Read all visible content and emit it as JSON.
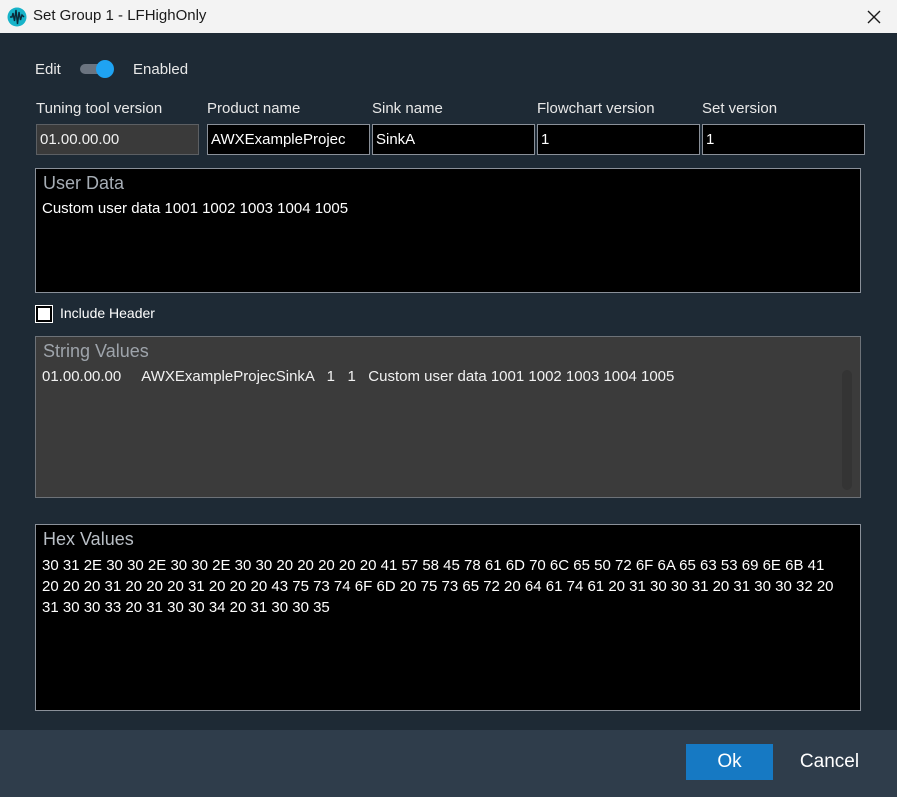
{
  "window": {
    "title": "Set Group 1 - LFHighOnly",
    "icon": "waveform-app-icon",
    "close_icon": "close-icon"
  },
  "edit": {
    "label": "Edit",
    "toggle_state": "on",
    "state_label": "Enabled",
    "accent_color": "#1fa3f2"
  },
  "fields": [
    {
      "label": "Tuning tool version",
      "value": "01.00.00.00",
      "readonly": true
    },
    {
      "label": "Product name",
      "value": "AWXExampleProjec"
    },
    {
      "label": "Sink name",
      "value": "SinkA"
    },
    {
      "label": "Flowchart version",
      "value": "1"
    },
    {
      "label": "Set version",
      "value": "1"
    }
  ],
  "user_data": {
    "title": "User Data",
    "text": "Custom user data 1001 1002 1003 1004 1005"
  },
  "include_header": {
    "label": "Include Header",
    "checked": false
  },
  "string_values": {
    "title": "String Values",
    "text": "01.00.00.00     AWXExampleProjecSinkA   1   1   Custom user data 1001 1002 1003 1004 1005"
  },
  "hex_values": {
    "title": "Hex Values",
    "text": "30 31 2E 30 30 2E 30 30 2E 30 30 20 20 20 20 20 41 57 58 45 78 61 6D 70 6C 65 50 72 6F 6A 65 63 53 69 6E 6B 41 20 20 20 31 20 20 20 31 20 20 20 43 75 73 74 6F 6D 20 75 73 65 72 20 64 61 74 61 20 31 30 30 31 20 31 30 30 32 20 31 30 30 33 20 31 30 30 34 20 31 30 30 35"
  },
  "footer": {
    "ok_label": "Ok",
    "cancel_label": "Cancel",
    "ok_color": "#1679c3"
  }
}
